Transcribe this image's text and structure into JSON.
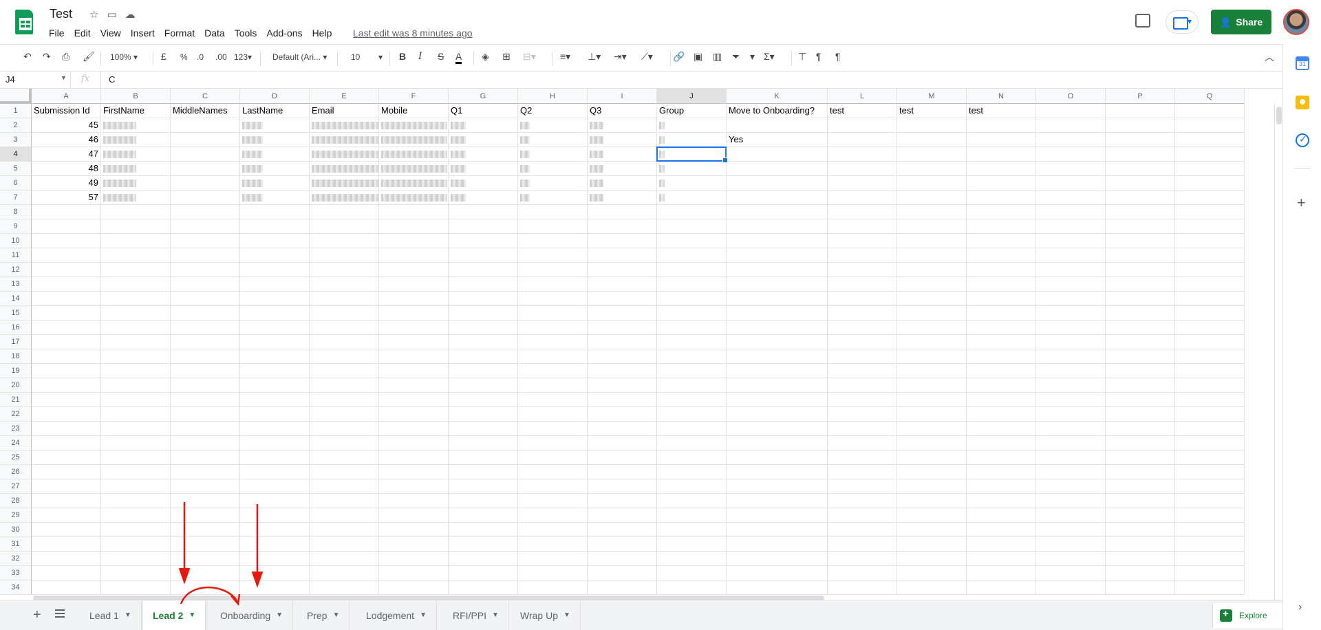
{
  "titlebar": {
    "doc_title": "Test",
    "menu": [
      "File",
      "Edit",
      "View",
      "Insert",
      "Format",
      "Data",
      "Tools",
      "Add-ons",
      "Help"
    ],
    "last_edit": "Last edit was 8 minutes ago",
    "share_label": "Share"
  },
  "toolbar": {
    "zoom": "100%",
    "currency": "£",
    "percent": "%",
    "decimal_less": ".0",
    "decimal_more": ".00",
    "format_more": "123",
    "font": "Default (Ari...",
    "font_size": "10",
    "bold": "B",
    "italic": "I",
    "strike": "S",
    "text_color": "A"
  },
  "formula_bar": {
    "name_box": "J4",
    "fx": "fx",
    "value": "C"
  },
  "columns": [
    "A",
    "B",
    "C",
    "D",
    "E",
    "F",
    "G",
    "H",
    "I",
    "J",
    "K",
    "L",
    "M",
    "N",
    "O",
    "P",
    "Q"
  ],
  "rows": [
    "1",
    "2",
    "3",
    "4",
    "5",
    "6",
    "7",
    "8",
    "9",
    "10",
    "11",
    "12",
    "13",
    "14",
    "15",
    "16",
    "17",
    "18",
    "19",
    "20",
    "21",
    "22",
    "23",
    "24",
    "25",
    "26",
    "27",
    "28",
    "29",
    "30",
    "31",
    "32",
    "33",
    "34"
  ],
  "header_row": [
    "Submission Id",
    "FirstName",
    "MiddleNames",
    "LastName",
    "Email",
    "Mobile",
    "Q1",
    "Q2",
    "Q3",
    "Group",
    "Move to Onboarding?",
    "test",
    "test",
    "test"
  ],
  "submission_ids": [
    "45",
    "46",
    "47",
    "48",
    "49",
    "57"
  ],
  "k3_value": "Yes",
  "sheet_tabs": [
    {
      "label": "Lead 1",
      "active": false
    },
    {
      "label": "Lead 2",
      "active": true
    },
    {
      "label": "Onboarding",
      "active": false
    },
    {
      "label": "Prep",
      "active": false
    },
    {
      "label": "Lodgement",
      "active": false
    },
    {
      "label": "RFI/PPI",
      "active": false
    },
    {
      "label": "Wrap Up",
      "active": false
    }
  ],
  "explore_label": "Explore",
  "colors": {
    "brand_green": "#188038",
    "selection_blue": "#1a73e8",
    "annotation_red": "#e8180c"
  }
}
